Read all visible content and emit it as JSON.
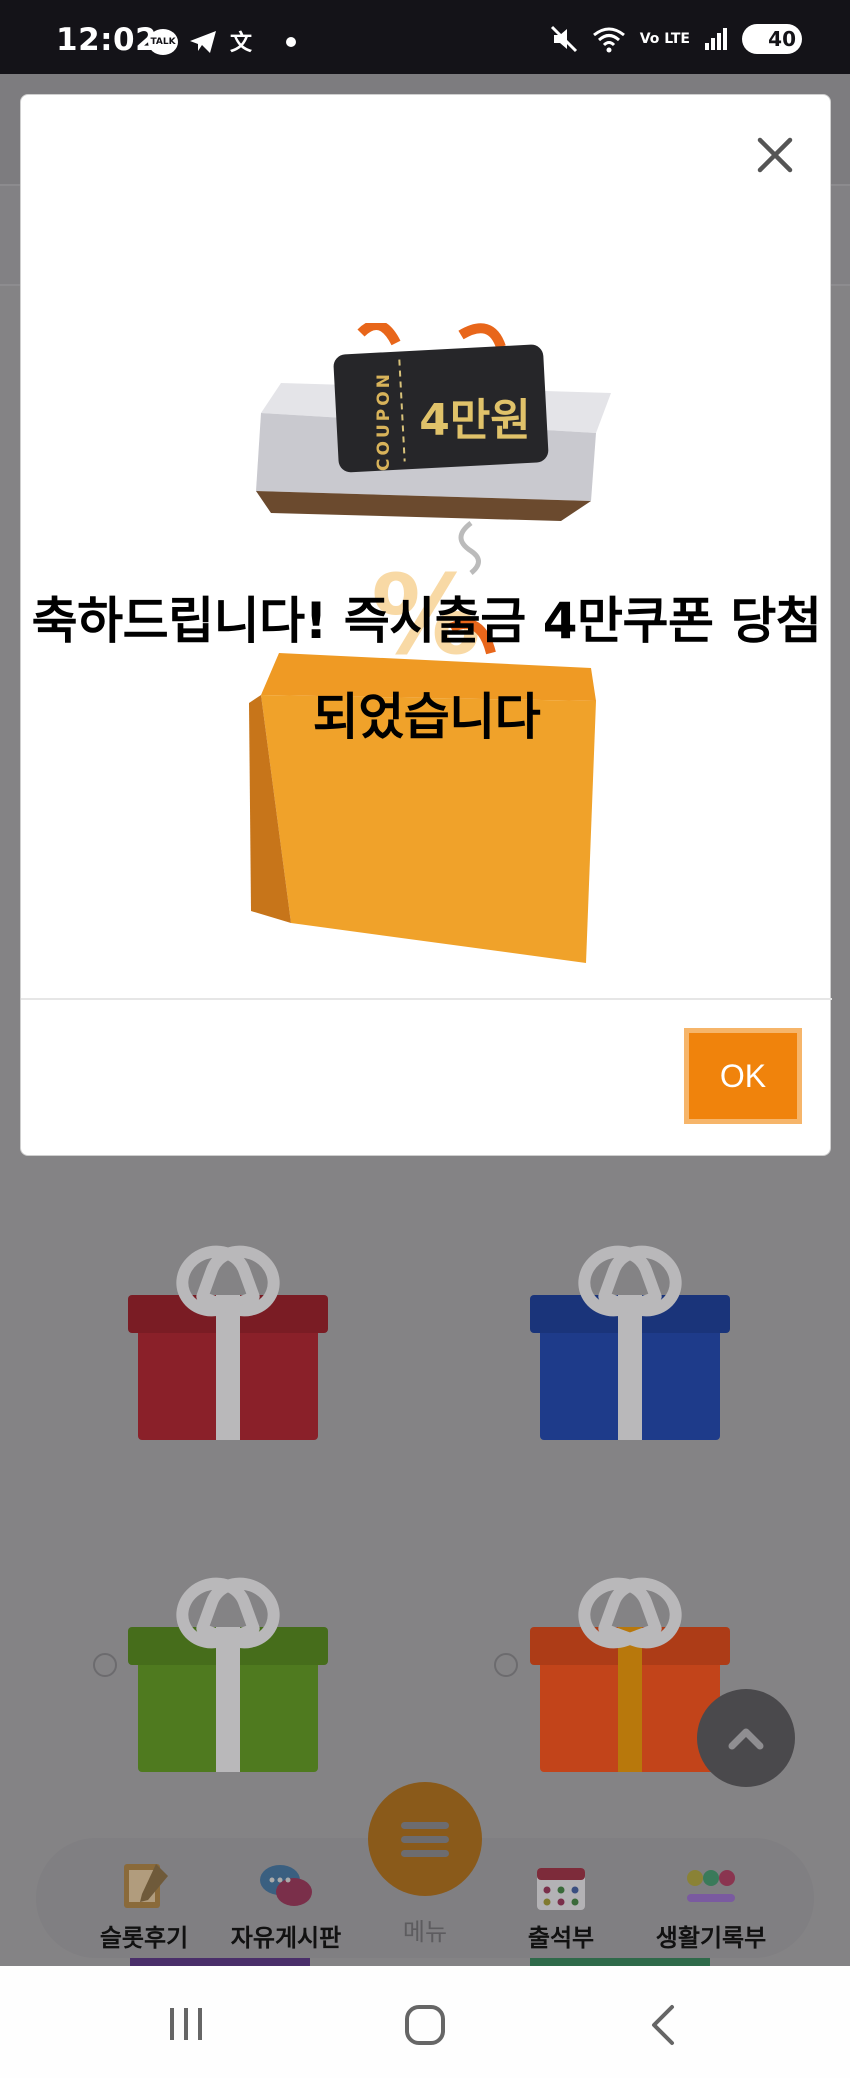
{
  "status_bar": {
    "time": "12:02",
    "talk_label": "TALK",
    "network_label": "Vo LTE",
    "battery": "40"
  },
  "modal": {
    "close_icon": "close-icon",
    "message": "축하드립니다! 즉시출금 4만쿠폰 당첨 되었습니다",
    "coupon_label": "COUPON",
    "coupon_amount": "4만원",
    "ok_label": "OK",
    "accent_color": "#f0830c"
  },
  "bottom_nav": {
    "items": [
      {
        "label": "슬롯후기",
        "icon": "review-icon"
      },
      {
        "label": "자유게시판",
        "icon": "chat-bubbles-icon"
      },
      {
        "label": "메뉴",
        "icon": "menu-icon"
      },
      {
        "label": "출석부",
        "icon": "calendar-icon"
      },
      {
        "label": "생활기록부",
        "icon": "emoji-record-icon"
      }
    ]
  },
  "gifts": [
    {
      "color": "#8a2029",
      "name": "red"
    },
    {
      "color": "#1e3b8a",
      "name": "blue"
    },
    {
      "color": "#4f7a1f",
      "name": "green"
    },
    {
      "color": "#c2441a",
      "name": "orange-red"
    }
  ]
}
